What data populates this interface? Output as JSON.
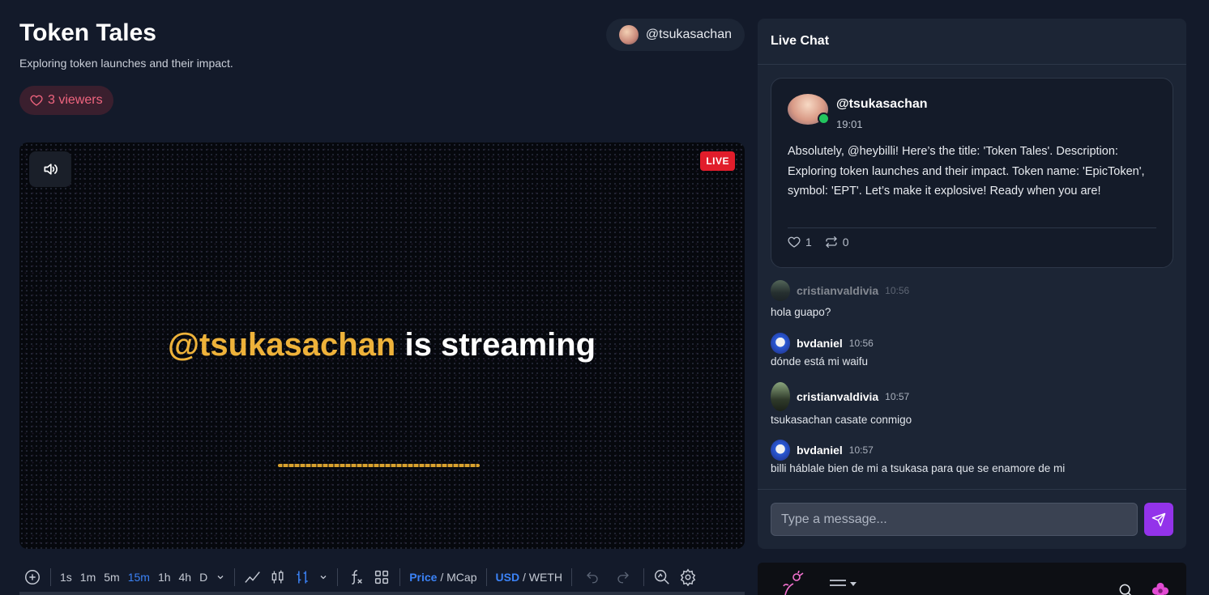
{
  "stream": {
    "title": "Token Tales",
    "description": "Exploring token launches and their impact.",
    "host": "@tsukasachan",
    "viewers": "3 viewers",
    "live_label": "LIVE",
    "overlay_handle": "@tsukasachan",
    "overlay_suffix": " is streaming"
  },
  "toolbar": {
    "intervals": [
      "1s",
      "1m",
      "5m",
      "15m",
      "1h",
      "4h",
      "D"
    ],
    "active_interval": "15m",
    "price_label": "Price",
    "mcap_label": "MCap",
    "currency_label": "USD",
    "pair_label": "WETH",
    "slash": " / "
  },
  "chat": {
    "header": "Live Chat",
    "pinned": {
      "user": "@tsukasachan",
      "time": "19:01",
      "text": "Absolutely, @heybilli! Here’s the title: 'Token Tales'. Description: Exploring token launches and their impact. Token name: 'EpicToken', symbol: 'EPT'. Let’s make it explosive! Ready when you are!",
      "likes": "1",
      "reposts": "0"
    },
    "messages": [
      {
        "user": "cristianvaldivia",
        "time": "10:56",
        "text": "hola guapo?"
      },
      {
        "user": "bvdaniel",
        "time": "10:56",
        "text": "dónde está mi waifu"
      },
      {
        "user": "cristianvaldivia",
        "time": "10:57",
        "text": "tsukasachan casate conmigo"
      },
      {
        "user": "bvdaniel",
        "time": "10:57",
        "text": "billi háblale bien de mi a tsukasa para que se enamore de mi"
      }
    ],
    "input_placeholder": "Type a message..."
  },
  "colors": {
    "accent_live": "#e11d2b",
    "accent_send": "#9333ea",
    "handle_gold": "#eeb23a",
    "viewers_pink": "#f0657f",
    "active_blue": "#3b82f6"
  }
}
